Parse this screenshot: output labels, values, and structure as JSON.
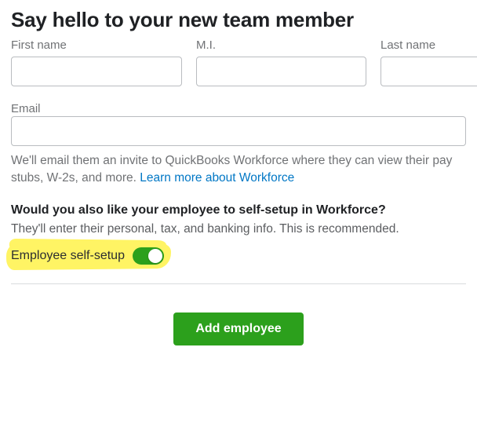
{
  "heading": "Say hello to your new team member",
  "fields": {
    "first_name": {
      "label": "First name",
      "value": ""
    },
    "mi": {
      "label": "M.I.",
      "value": ""
    },
    "last_name": {
      "label": "Last name",
      "value": ""
    },
    "email": {
      "label": "Email",
      "value": ""
    }
  },
  "email_helper_pre": "We'll email them an invite to QuickBooks Workforce where they can view their pay stubs, W-2s, and more. ",
  "email_helper_link": "Learn more about Workforce",
  "self_setup": {
    "question": "Would you also like your employee to self-setup in Workforce?",
    "desc": "They'll enter their personal, tax, and banking info. This is recommended.",
    "toggle_label": "Employee self-setup",
    "toggle_on": true
  },
  "primary_button": "Add employee"
}
